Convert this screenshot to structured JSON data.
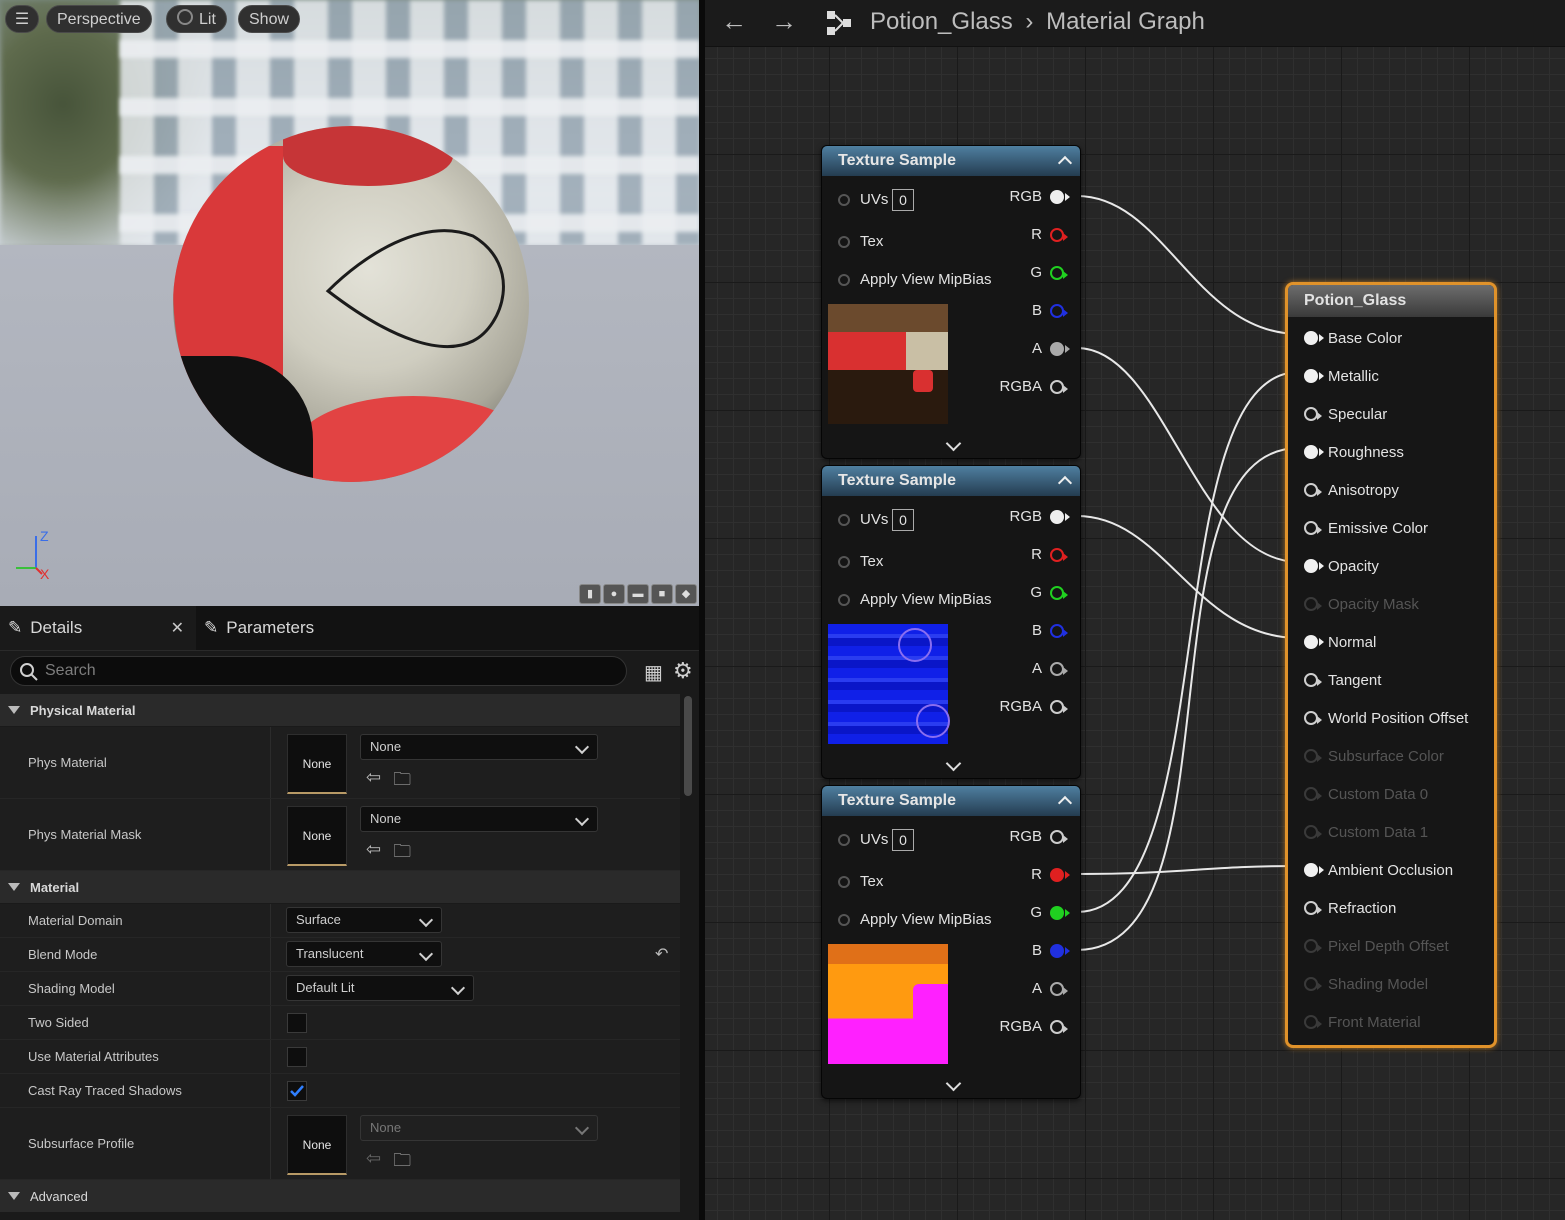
{
  "viewport": {
    "buttons": {
      "menu": "",
      "perspective": "Perspective",
      "lit": "Lit",
      "show": "Show"
    },
    "axes": {
      "z": "Z",
      "x": "X"
    }
  },
  "details": {
    "tabs": [
      {
        "label": "Details"
      },
      {
        "label": "Parameters"
      }
    ],
    "search_placeholder": "Search",
    "sections": {
      "physical_material": {
        "title": "Physical Material",
        "phys_material": {
          "label": "Phys Material",
          "thumb": "None",
          "value": "None"
        },
        "phys_material_mask": {
          "label": "Phys Material Mask",
          "thumb": "None",
          "value": "None"
        }
      },
      "material": {
        "title": "Material",
        "material_domain": {
          "label": "Material Domain",
          "value": "Surface"
        },
        "blend_mode": {
          "label": "Blend Mode",
          "value": "Translucent"
        },
        "shading_model": {
          "label": "Shading Model",
          "value": "Default Lit"
        },
        "two_sided": {
          "label": "Two Sided",
          "checked": false
        },
        "use_material_attributes": {
          "label": "Use Material Attributes",
          "checked": false
        },
        "cast_ray_traced_shadows": {
          "label": "Cast Ray Traced Shadows",
          "checked": true
        },
        "subsurface_profile": {
          "label": "Subsurface Profile",
          "thumb": "None",
          "value": "None"
        }
      },
      "advanced": {
        "title": "Advanced"
      }
    }
  },
  "graph": {
    "breadcrumb": {
      "asset": "Potion_Glass",
      "separator": "›",
      "page": "Material Graph"
    },
    "texture_nodes": [
      {
        "title": "Texture Sample",
        "uv_label": "UVs",
        "uv_value": "0",
        "tex": "Tex",
        "mip": "Apply View MipBias",
        "outputs": [
          "RGB",
          "R",
          "G",
          "B",
          "A",
          "RGBA"
        ]
      },
      {
        "title": "Texture Sample",
        "uv_label": "UVs",
        "uv_value": "0",
        "tex": "Tex",
        "mip": "Apply View MipBias",
        "outputs": [
          "RGB",
          "R",
          "G",
          "B",
          "A",
          "RGBA"
        ]
      },
      {
        "title": "Texture Sample",
        "uv_label": "UVs",
        "uv_value": "0",
        "tex": "Tex",
        "mip": "Apply View MipBias",
        "outputs": [
          "RGB",
          "R",
          "G",
          "B",
          "A",
          "RGBA"
        ]
      }
    ],
    "material_node": {
      "title": "Potion_Glass",
      "inputs": [
        {
          "label": "Base Color",
          "enabled": true,
          "connected": true
        },
        {
          "label": "Metallic",
          "enabled": true,
          "connected": true
        },
        {
          "label": "Specular",
          "enabled": true,
          "connected": false
        },
        {
          "label": "Roughness",
          "enabled": true,
          "connected": true
        },
        {
          "label": "Anisotropy",
          "enabled": true,
          "connected": false
        },
        {
          "label": "Emissive Color",
          "enabled": true,
          "connected": false
        },
        {
          "label": "Opacity",
          "enabled": true,
          "connected": true
        },
        {
          "label": "Opacity Mask",
          "enabled": false,
          "connected": false
        },
        {
          "label": "Normal",
          "enabled": true,
          "connected": true
        },
        {
          "label": "Tangent",
          "enabled": true,
          "connected": false
        },
        {
          "label": "World Position Offset",
          "enabled": true,
          "connected": false
        },
        {
          "label": "Subsurface Color",
          "enabled": false,
          "connected": false
        },
        {
          "label": "Custom Data 0",
          "enabled": false,
          "connected": false
        },
        {
          "label": "Custom Data 1",
          "enabled": false,
          "connected": false
        },
        {
          "label": "Ambient Occlusion",
          "enabled": true,
          "connected": true
        },
        {
          "label": "Refraction",
          "enabled": true,
          "connected": false
        },
        {
          "label": "Pixel Depth Offset",
          "enabled": false,
          "connected": false
        },
        {
          "label": "Shading Model",
          "enabled": false,
          "connected": false
        },
        {
          "label": "Front Material",
          "enabled": false,
          "connected": false
        }
      ]
    }
  },
  "colors": {
    "accent": "#e0922a",
    "pin_r": "#e02020",
    "pin_g": "#20d020",
    "pin_b": "#2030e0",
    "pin_white": "#e8e8e8"
  }
}
